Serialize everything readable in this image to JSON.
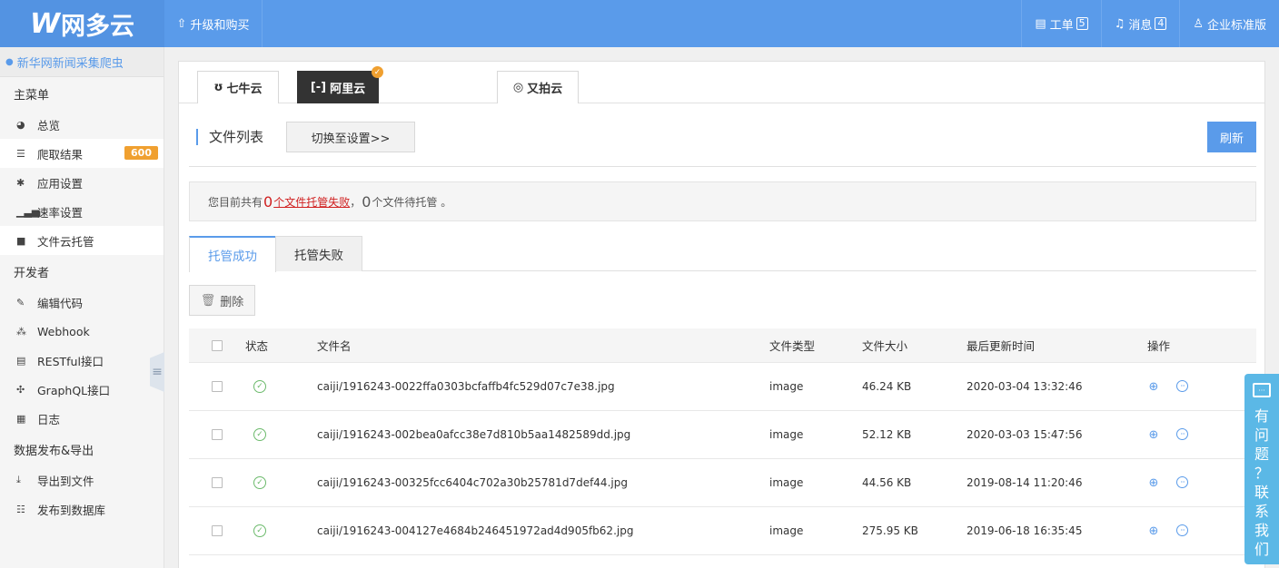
{
  "header": {
    "logo_w": "W",
    "logo_text": "网多云",
    "upgrade_label": "升级和购买",
    "tickets_label": "工单",
    "tickets_count": "5",
    "messages_label": "消息",
    "messages_count": "4",
    "account_label": "企业标准版"
  },
  "sidebar": {
    "project_name": "新华网新闻采集爬虫",
    "sections": [
      {
        "title": "主菜单",
        "items": [
          {
            "icon": "dashboard-icon",
            "label": "总览"
          },
          {
            "icon": "list-icon",
            "label": "爬取结果",
            "badge": "600"
          },
          {
            "icon": "gear-icon",
            "label": "应用设置"
          },
          {
            "icon": "bar-chart-icon",
            "label": "速率设置"
          },
          {
            "icon": "folder-icon",
            "label": "文件云托管"
          }
        ]
      },
      {
        "title": "开发者",
        "items": [
          {
            "icon": "edit-icon",
            "label": "编辑代码"
          },
          {
            "icon": "webhook-icon",
            "label": "Webhook"
          },
          {
            "icon": "api-icon",
            "label": "RESTful接口"
          },
          {
            "icon": "graph-icon",
            "label": "GraphQL接口"
          },
          {
            "icon": "calendar-icon",
            "label": "日志"
          }
        ]
      },
      {
        "title": "数据发布&导出",
        "items": [
          {
            "icon": "download-icon",
            "label": "导出到文件"
          },
          {
            "icon": "database-icon",
            "label": "发布到数据库"
          }
        ]
      }
    ]
  },
  "cloud_tabs": [
    {
      "label": "七牛云",
      "icon": "qiniu-logo-icon"
    },
    {
      "label": "阿里云",
      "icon": "aliyun-logo-icon"
    },
    {
      "label": "又拍云",
      "icon": "upyun-logo-icon"
    }
  ],
  "file_list": {
    "title": "文件列表",
    "switch_label": "切换至设置>>",
    "refresh_label": "刷新",
    "notice_prefix": "您目前共有",
    "fail_count": "0",
    "fail_text": "个文件托管失败",
    "notice_sep": "，",
    "pending_count": "0",
    "pending_text": "个文件待托管 。",
    "tab_success": "托管成功",
    "tab_failed": "托管失败",
    "delete_label": "删除"
  },
  "table": {
    "headers": {
      "status": "状态",
      "name": "文件名",
      "type": "文件类型",
      "size": "文件大小",
      "time": "最后更新时间",
      "ops": "操作"
    },
    "rows": [
      {
        "name": "caiji/1916243-0022ffa0303bcfaffb4fc529d07c7e38.jpg",
        "type": "image",
        "size": "46.24 KB",
        "time": "2020-03-04 13:32:46"
      },
      {
        "name": "caiji/1916243-002bea0afcc38e7d810b5aa1482589dd.jpg",
        "type": "image",
        "size": "52.12 KB",
        "time": "2020-03-03 15:47:56"
      },
      {
        "name": "caiji/1916243-00325fcc6404c702a30b25781d7def44.jpg",
        "type": "image",
        "size": "44.56 KB",
        "time": "2019-08-14 11:20:46"
      },
      {
        "name": "caiji/1916243-004127e4684b246451972ad4d905fb62.jpg",
        "type": "image",
        "size": "275.95 KB",
        "time": "2019-06-18 16:35:45"
      }
    ]
  },
  "help": {
    "chars": [
      "有",
      "问",
      "题",
      "？",
      "联",
      "系",
      "我",
      "们"
    ]
  }
}
